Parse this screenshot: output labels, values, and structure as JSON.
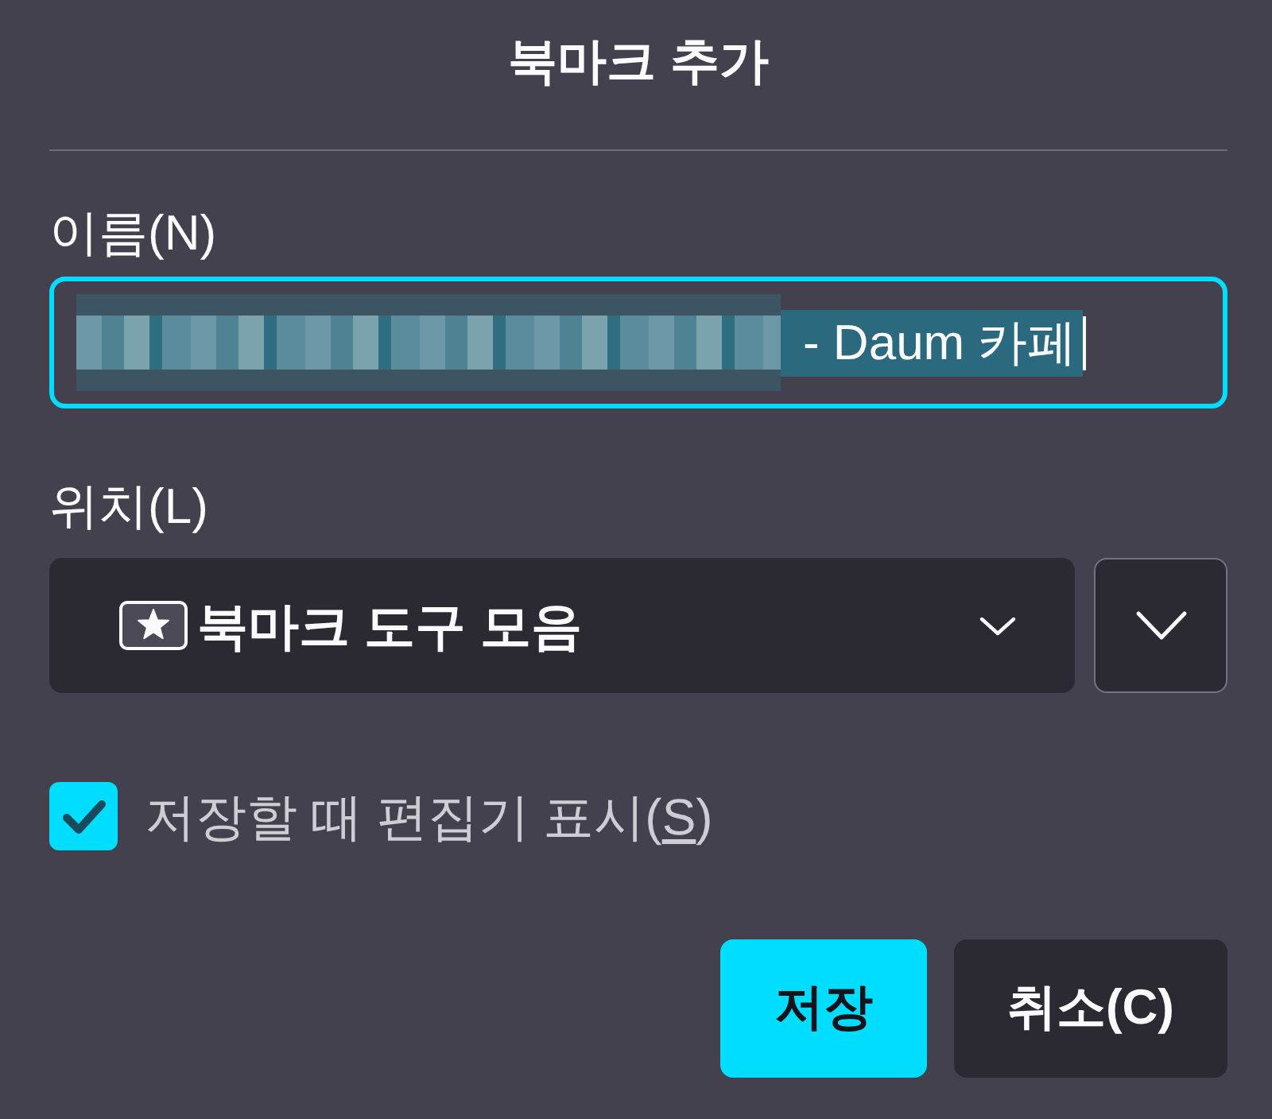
{
  "dialog": {
    "title": "북마크 추가"
  },
  "name_field": {
    "label": "이름(N)",
    "focused": true,
    "obscured_prefix": true,
    "value": "- Daum 카페",
    "text_selected": true
  },
  "location_field": {
    "label": "위치(L)",
    "value": "북마크 도구 모음"
  },
  "show_editor_checkbox": {
    "checked": true,
    "label_parts": [
      {
        "text": "저장할 때 편집기 표시(",
        "underlined": false
      },
      {
        "text": "S",
        "underlined": true
      },
      {
        "text": ")",
        "underlined": false
      }
    ]
  },
  "buttons": [
    {
      "label": "저장",
      "kind": "primary"
    },
    {
      "label": "취소(C)",
      "kind": "secondary"
    }
  ]
}
